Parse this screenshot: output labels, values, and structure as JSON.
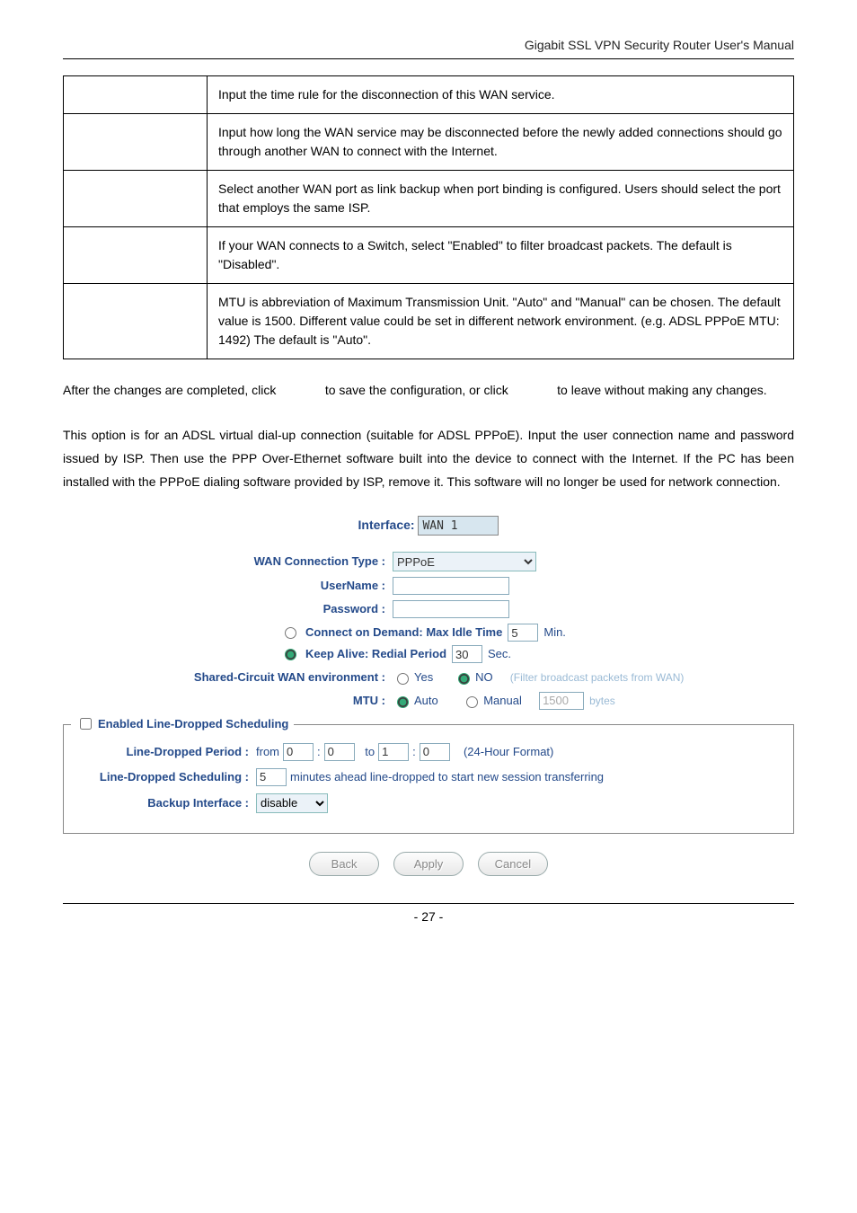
{
  "header": {
    "title": "Gigabit SSL VPN Security Router User's Manual"
  },
  "table_rows": [
    "Input the time rule for the disconnection of this WAN service.",
    "Input how long the WAN service may be disconnected before the newly added connections should go through another WAN to connect with the Internet.",
    "Select another WAN port as link backup when port binding is configured. Users should select the port that employs the same ISP.",
    "If your WAN connects to a Switch, select \"Enabled\" to filter broadcast packets. The default is \"Disabled\".",
    "MTU is abbreviation of Maximum Transmission Unit. \"Auto\" and \"Manual\" can be chosen. The default value is 1500. Different value could be set in different network environment. (e.g. ADSL PPPoE MTU: 1492) The default is \"Auto\"."
  ],
  "para1": {
    "pre": "After the changes are completed, click ",
    "mid": " to save the configuration, or click ",
    "post": " to leave without making any changes."
  },
  "para2": "This option is for an ADSL virtual dial-up connection (suitable for ADSL PPPoE). Input the user connection name and password issued by ISP. Then use the PPP Over-Ethernet software built into the device to connect with the Internet. If the PC has been installed with the PPPoE dialing software provided by ISP, remove it. This software will no longer be used for network connection.",
  "interface": {
    "label": "Interface:",
    "value": "WAN 1"
  },
  "form": {
    "conn_type_label": "WAN Connection Type :",
    "conn_type_value": "PPPoE",
    "username_label": "UserName :",
    "username_value": "",
    "password_label": "Password :",
    "password_value": "",
    "connect_demand_label": "Connect on Demand: Max Idle Time",
    "connect_demand_value": "5",
    "connect_demand_unit": "Min.",
    "keep_alive_label": "Keep Alive: Redial Period",
    "keep_alive_value": "30",
    "keep_alive_unit": "Sec.",
    "shared_label": "Shared-Circuit WAN environment :",
    "shared_yes": "Yes",
    "shared_no": "NO",
    "shared_note": "(Filter broadcast packets from WAN)",
    "mtu_label": "MTU :",
    "mtu_auto": "Auto",
    "mtu_manual": "Manual",
    "mtu_value": "1500",
    "mtu_unit": "bytes"
  },
  "box": {
    "legend": "Enabled Line-Dropped Scheduling",
    "period_label": "Line-Dropped Period :",
    "period_from": "from",
    "period_to": "to",
    "p_from_h": "0",
    "p_from_m": "0",
    "p_to_h": "1",
    "p_to_m": "0",
    "hour_format": "(24-Hour Format)",
    "sched_label": "Line-Dropped Scheduling :",
    "sched_value": "5",
    "sched_note": "minutes ahead line-dropped to start new session transferring",
    "backup_label": "Backup Interface :",
    "backup_value": "disable"
  },
  "buttons": {
    "back": "Back",
    "apply": "Apply",
    "cancel": "Cancel"
  },
  "footer": {
    "page": "- 27 -"
  }
}
